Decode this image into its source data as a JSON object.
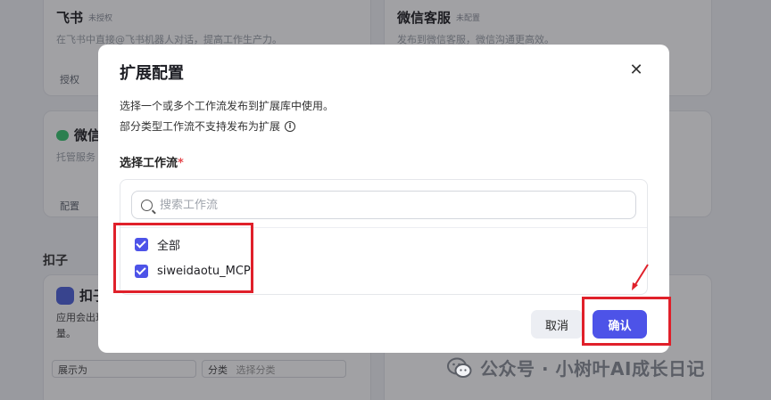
{
  "background": {
    "cards": [
      {
        "title": "飞书",
        "tag": "未授权",
        "desc": "在飞书中直接@飞书机器人对话，提高工作生产力。",
        "foot": "授权"
      },
      {
        "title": "微信客服",
        "tag": "未配置",
        "desc": "发布到微信客服，微信沟通更高效。",
        "foot": ""
      },
      {
        "title": "微信",
        "tag": "",
        "desc": "托管服务",
        "foot": "配置"
      },
      {
        "title": "扣子",
        "tag": "",
        "desc": "应用会出现",
        "foot": ""
      }
    ],
    "section_title": "扣子",
    "card4_line2": "量。",
    "select_display": "展示为",
    "select_category_label": "分类",
    "select_category_placeholder": "选择分类"
  },
  "modal": {
    "title": "扩展配置",
    "close_label": "✕",
    "description_line1": "选择一个或多个工作流发布到扩展库中使用。",
    "description_line2": "部分类型工作流不支持发布为扩展",
    "info_icon": "i",
    "field_label": "选择工作流",
    "required_mark": "*",
    "search_placeholder": "搜索工作流",
    "options": [
      {
        "label": "全部",
        "checked": true
      },
      {
        "label": "siweidaotu_MCP",
        "checked": true
      }
    ],
    "cancel_label": "取消",
    "confirm_label": "确认"
  },
  "watermark": "公众号 · 小树叶AI成长日记",
  "colors": {
    "accent": "#4d53e8",
    "annotation": "#e0202a"
  }
}
